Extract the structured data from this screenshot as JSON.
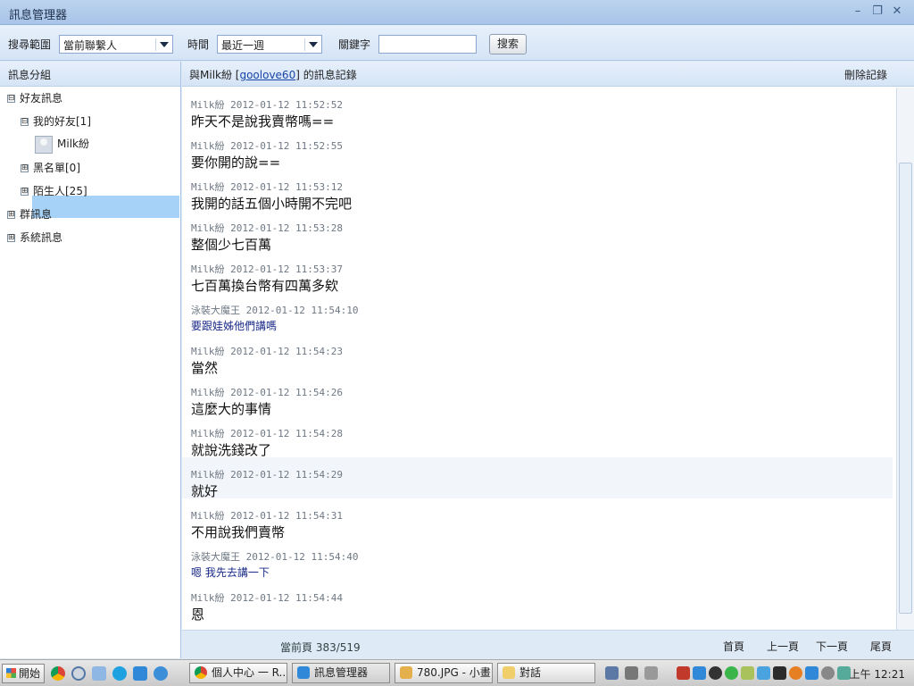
{
  "window": {
    "title": "訊息管理器",
    "buttons": [
      "minimize",
      "restore",
      "close"
    ]
  },
  "search": {
    "range_label": "搜尋範圍",
    "range_value": "當前聯繫人",
    "time_label": "時間",
    "time_value": "最近一週",
    "keyword_label": "關鍵字",
    "keyword_value": "",
    "search_button": "搜索"
  },
  "left_panel": {
    "header": "訊息分組",
    "tree": [
      {
        "label": "好友訊息",
        "expander": "⊟"
      },
      {
        "label": "我的好友[1]",
        "expander": "⊟"
      },
      {
        "label": "Milk紛",
        "expander": ""
      },
      {
        "label": "黑名單[0]",
        "expander": "⊞"
      },
      {
        "label": "陌生人[25]",
        "expander": "⊞"
      },
      {
        "label": "群訊息",
        "expander": "⊞"
      },
      {
        "label": "系統訊息",
        "expander": "⊞"
      }
    ]
  },
  "conversation": {
    "header_prefix": "與Milk紛 [",
    "header_link": "goolove60",
    "header_suffix": "] 的訊息記錄",
    "delete_label": "刪除記錄",
    "messages": [
      {
        "meta": "Milk紛 2012-01-12 11:52:52",
        "text": "昨天不是說我賣幣嗎==",
        "from_me": false
      },
      {
        "meta": "Milk紛 2012-01-12 11:52:55",
        "text": "要你開的說==",
        "from_me": false
      },
      {
        "meta": "Milk紛 2012-01-12 11:53:12",
        "text": "我開的話五個小時開不完吧",
        "from_me": false
      },
      {
        "meta": "Milk紛 2012-01-12 11:53:28",
        "text": "整個少七百萬",
        "from_me": false
      },
      {
        "meta": "Milk紛 2012-01-12 11:53:37",
        "text": "七百萬換台幣有四萬多欸",
        "from_me": false
      },
      {
        "meta": "泳裝大魔王 2012-01-12 11:54:10",
        "text": "要跟娃姊他們講嗎",
        "from_me": true
      },
      {
        "meta": "Milk紛 2012-01-12 11:54:23",
        "text": "當然",
        "from_me": false
      },
      {
        "meta": "Milk紛 2012-01-12 11:54:26",
        "text": "這麼大的事情",
        "from_me": false
      },
      {
        "meta": "Milk紛 2012-01-12 11:54:28",
        "text": "就說洗錢改了",
        "from_me": false
      },
      {
        "meta": "Milk紛 2012-01-12 11:54:29",
        "text": "就好",
        "from_me": false
      },
      {
        "meta": "Milk紛 2012-01-12 11:54:31",
        "text": "不用說我們賣幣",
        "from_me": false
      },
      {
        "meta": "泳裝大魔王 2012-01-12 11:54:40",
        "text": "嗯 我先去講一下",
        "from_me": true
      },
      {
        "meta": "Milk紛 2012-01-12 11:54:44",
        "text": "恩",
        "from_me": false
      }
    ]
  },
  "pager": {
    "current": "當前頁 383/519",
    "first": "首頁",
    "prev": "上一頁",
    "next": "下一頁",
    "last": "尾頁"
  },
  "taskbar": {
    "start": "開始",
    "tasks": [
      "個人中心 一 R...",
      "訊息管理器",
      "780.JPG - 小畫...",
      "對話"
    ],
    "clock": "上午 12:21"
  }
}
